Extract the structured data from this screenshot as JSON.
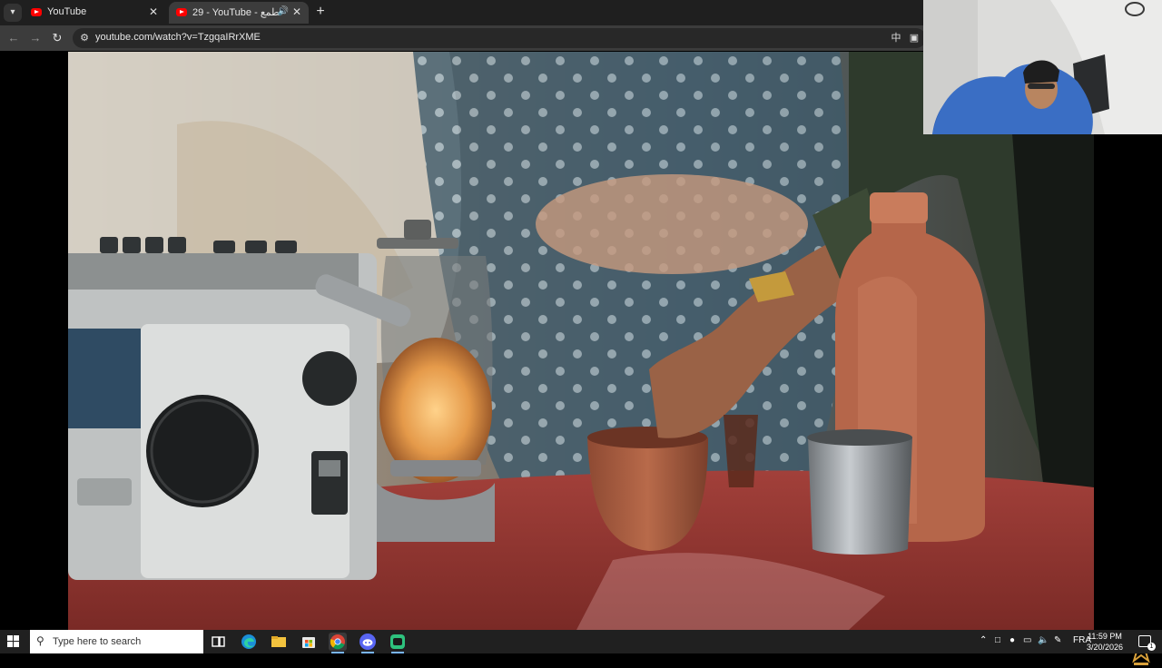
{
  "browser": {
    "tabs": [
      {
        "title": "YouTube",
        "active": false,
        "icon": "youtube-icon"
      },
      {
        "title": "29 - YouTube - عش الطمع",
        "active": true,
        "icon": "youtube-icon",
        "audio_icon": "speaker-icon"
      }
    ],
    "new_tab_label": "+",
    "address": {
      "url": "youtube.com/watch?v=TzgqaIRrXME"
    }
  },
  "taskbar": {
    "search_placeholder": "Type here to search",
    "language": "FRA",
    "time": "11:59 PM",
    "date": "3/20/2026",
    "apps": [
      "task-view-icon",
      "edge-icon",
      "file-explorer-icon",
      "store-icon",
      "chrome-icon",
      "discord-icon",
      "obs-icon"
    ]
  },
  "colors": {
    "tabbar": "#1f1f1f",
    "toolbar": "#3c3c3c",
    "youtube_red": "#ff0000",
    "taskbar": "#202020"
  }
}
